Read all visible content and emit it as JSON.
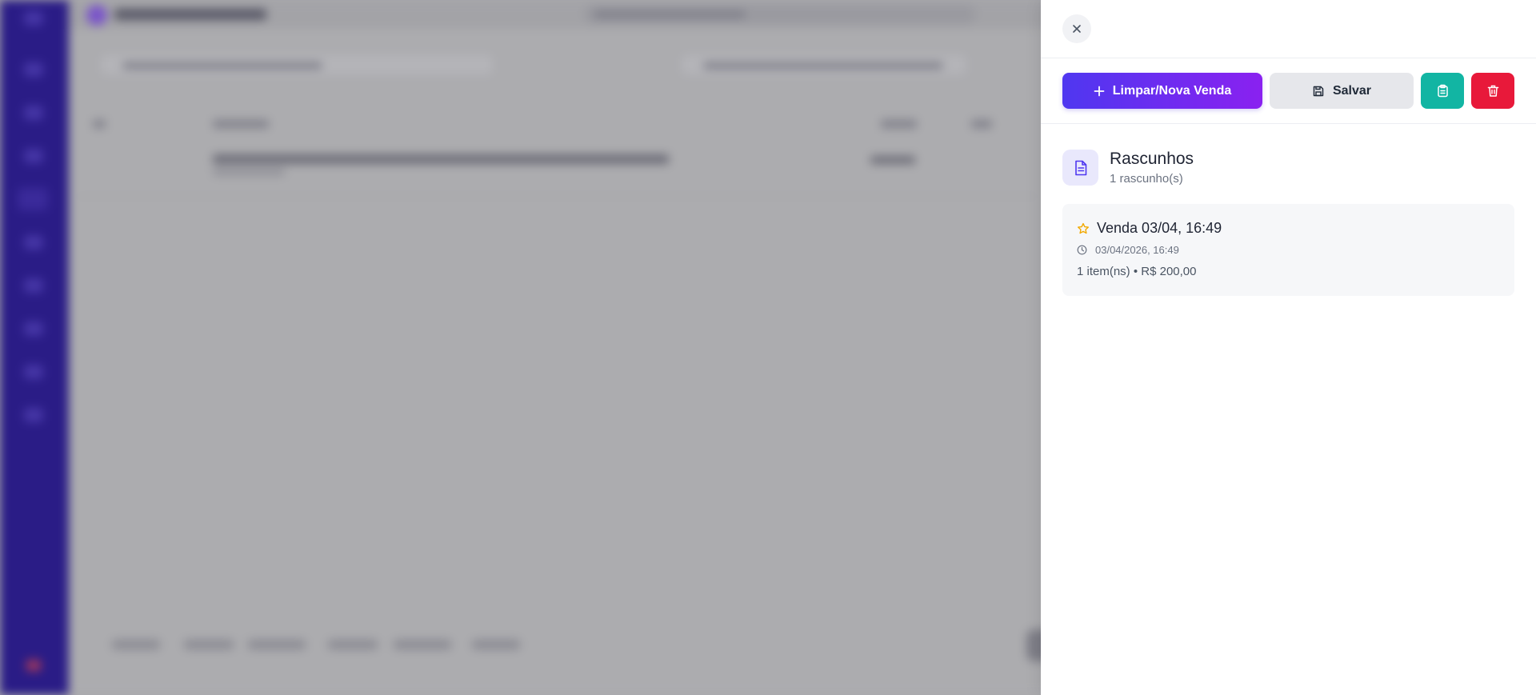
{
  "toolbar": {
    "new_sale_label": "Limpar/Nova Venda",
    "save_label": "Salvar"
  },
  "drafts": {
    "title": "Rascunhos",
    "count_label": "1 rascunho(s)",
    "items": [
      {
        "title": "Venda 03/04, 16:49",
        "datetime": "03/04/2026, 16:49",
        "summary": "1 item(ns) • R$ 200,00"
      }
    ]
  },
  "colors": {
    "primary_gradient_start": "#4f37f0",
    "primary_gradient_end": "#8a21f0",
    "teal_button": "#12b5a3",
    "red_button": "#e8193a",
    "star_icon": "#f2a900",
    "sidebar": "#2a1c86"
  },
  "icons": {
    "close": "close-icon",
    "new_sale": "plus-icon",
    "save": "floppy-disk-icon",
    "teal_action": "clipboard-icon",
    "red_action": "trash-icon",
    "section": "document-icon",
    "draft_favorite": "star-icon",
    "draft_time": "clock-icon"
  }
}
